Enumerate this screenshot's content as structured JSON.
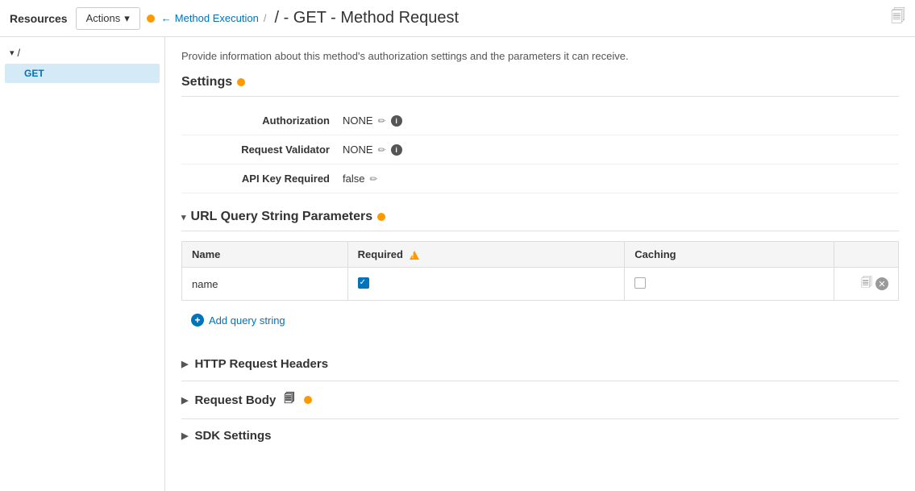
{
  "topbar": {
    "resources_label": "Resources",
    "actions_label": "Actions",
    "back_arrow": "←",
    "breadcrumb_label": "Method Execution",
    "separator": "/",
    "page_title": "/ - GET - Method Request",
    "doc_icon": "🗐"
  },
  "sidebar": {
    "root_path": "/",
    "get_label": "GET"
  },
  "content": {
    "description": "Provide information about this method's authorization settings and the parameters it can receive.",
    "settings": {
      "header": "Settings",
      "authorization_label": "Authorization",
      "authorization_value": "NONE",
      "request_validator_label": "Request Validator",
      "request_validator_value": "NONE",
      "api_key_label": "API Key Required",
      "api_key_value": "false"
    },
    "url_query": {
      "header": "URL Query String Parameters",
      "columns": [
        "Name",
        "Required",
        "Caching"
      ],
      "rows": [
        {
          "name": "name",
          "required": true,
          "caching": false
        }
      ],
      "add_label": "Add query string"
    },
    "http_headers": {
      "header": "HTTP Request Headers"
    },
    "request_body": {
      "header": "Request Body"
    },
    "sdk_settings": {
      "header": "SDK Settings"
    }
  }
}
